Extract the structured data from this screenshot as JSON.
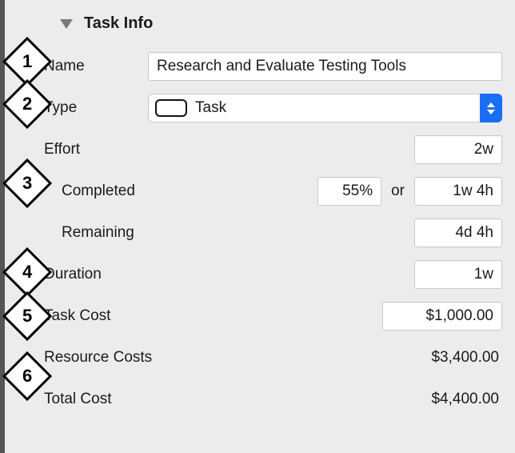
{
  "section": {
    "title": "Task Info"
  },
  "labels": {
    "name": "Name",
    "type": "Type",
    "effort": "Effort",
    "completed": "Completed",
    "remaining": "Remaining",
    "duration": "Duration",
    "task_cost": "Task Cost",
    "resource_costs": "Resource Costs",
    "total_cost": "Total Cost",
    "or": "or"
  },
  "values": {
    "name": "Research and Evaluate Testing Tools",
    "type": "Task",
    "effort": "2w",
    "completed_pct": "55%",
    "completed_time": "1w 4h",
    "remaining": "4d 4h",
    "duration": "1w",
    "task_cost": "$1,000.00",
    "resource_costs": "$3,400.00",
    "total_cost": "$4,400.00"
  },
  "callouts": {
    "c1": "1",
    "c2": "2",
    "c3": "3",
    "c4": "4",
    "c5": "5",
    "c6": "6"
  }
}
